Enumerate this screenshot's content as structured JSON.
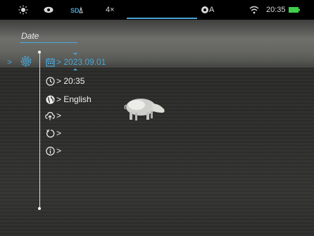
{
  "statusbar": {
    "zoom": "4×",
    "mode_letter": "A",
    "time": "20:35",
    "battery_color": "#3fcf4a"
  },
  "menu": {
    "title": "Date",
    "items": [
      {
        "icon": "calendar-icon",
        "label": "> 2023.09.01"
      },
      {
        "icon": "clock-icon",
        "label": "> 20:35"
      },
      {
        "icon": "globe-icon",
        "label": "> English"
      },
      {
        "icon": "cloud-upload-icon",
        "label": ">"
      },
      {
        "icon": "reset-icon",
        "label": ">"
      },
      {
        "icon": "info-icon",
        "label": ">"
      }
    ]
  },
  "colors": {
    "accent": "#4aa6d6"
  }
}
